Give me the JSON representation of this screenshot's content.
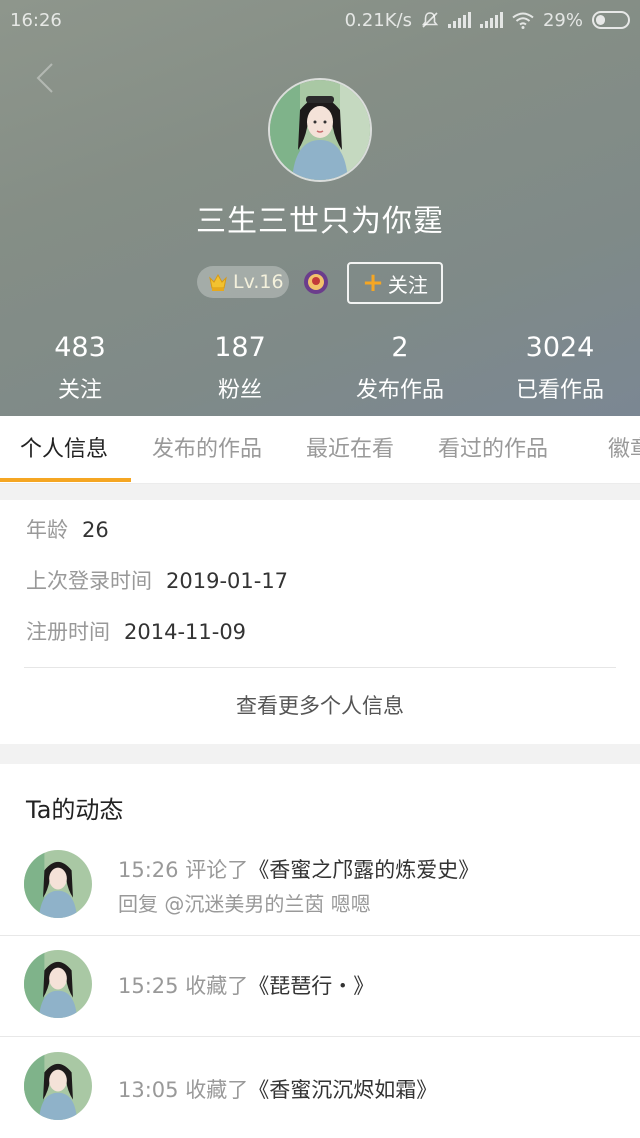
{
  "status_bar": {
    "time": "16:26",
    "net_speed": "0.21K/s",
    "battery": "29%",
    "icons": [
      "mute-icon",
      "signal-icon",
      "signal-icon",
      "wifi-icon",
      "battery-icon"
    ]
  },
  "profile": {
    "nickname": "三生三世只为你霆",
    "level": "Lv.16",
    "follow_label": "关注",
    "stats": [
      {
        "num": "483",
        "label": "关注"
      },
      {
        "num": "187",
        "label": "粉丝"
      },
      {
        "num": "2",
        "label": "发布作品"
      },
      {
        "num": "3024",
        "label": "已看作品"
      }
    ]
  },
  "tabs": [
    "个人信息",
    "发布的作品",
    "最近在看",
    "看过的作品",
    "徽章"
  ],
  "active_tab": 0,
  "info": {
    "age_label": "年龄",
    "age_value": "26",
    "last_login_label": "上次登录时间",
    "last_login_value": "2019-01-17",
    "register_label": "注册时间",
    "register_value": "2014-11-09",
    "more_label": "查看更多个人信息"
  },
  "activity": {
    "title": "Ta的动态",
    "items": [
      {
        "time": "15:26",
        "action": "评论了",
        "work": "《香蜜之邝露的炼爱史》",
        "reply": "回复 @沉迷美男的兰茵 嗯嗯"
      },
      {
        "time": "15:25",
        "action": "收藏了",
        "work": "《琵琶行・》",
        "reply": ""
      },
      {
        "time": "13:05",
        "action": "收藏了",
        "work": "《香蜜沉沉烬如霜》",
        "reply": ""
      }
    ]
  },
  "colors": {
    "accent": "#f5a623",
    "hero_bg": "#858e86",
    "muted_text": "#999999"
  }
}
